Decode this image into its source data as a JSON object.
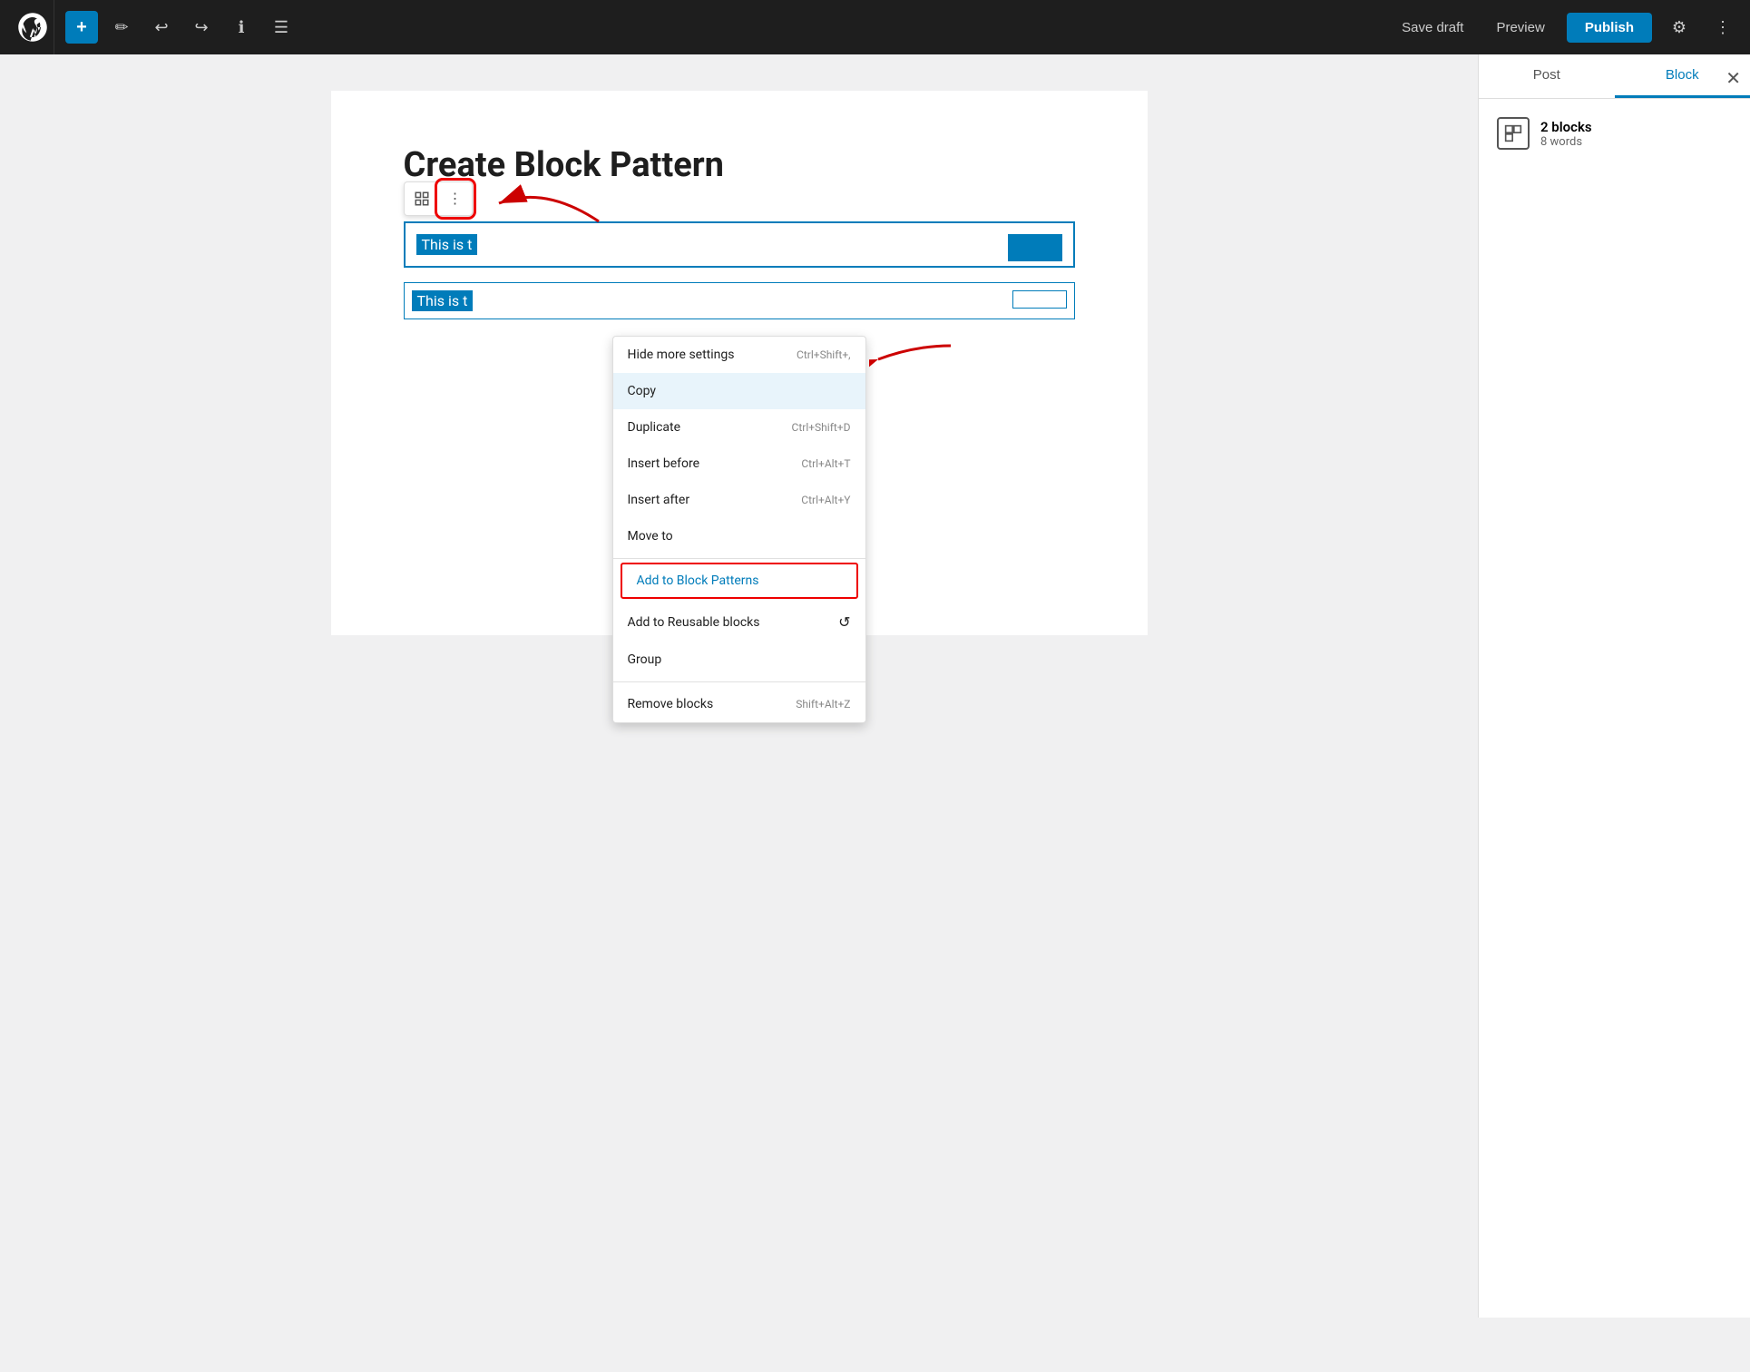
{
  "toolbar": {
    "add_label": "+",
    "save_draft": "Save draft",
    "preview": "Preview",
    "publish": "Publish"
  },
  "editor": {
    "title": "Create Block Pattern"
  },
  "block1": {
    "text": "This is t"
  },
  "block2": {
    "text": "This is t"
  },
  "context_menu": {
    "hide_settings": "Hide more settings",
    "hide_shortcut": "Ctrl+Shift+,",
    "copy": "Copy",
    "duplicate": "Duplicate",
    "duplicate_shortcut": "Ctrl+Shift+D",
    "insert_before": "Insert before",
    "insert_before_shortcut": "Ctrl+Alt+T",
    "insert_after": "Insert after",
    "insert_after_shortcut": "Ctrl+Alt+Y",
    "move_to": "Move to",
    "add_to_block_patterns": "Add to Block Patterns",
    "add_to_reusable": "Add to Reusable blocks",
    "group": "Group",
    "remove_blocks": "Remove blocks",
    "remove_shortcut": "Shift+Alt+Z"
  },
  "right_panel": {
    "post_tab": "Post",
    "block_tab": "Block",
    "blocks_count": "2 blocks",
    "words_count": "8 words"
  }
}
